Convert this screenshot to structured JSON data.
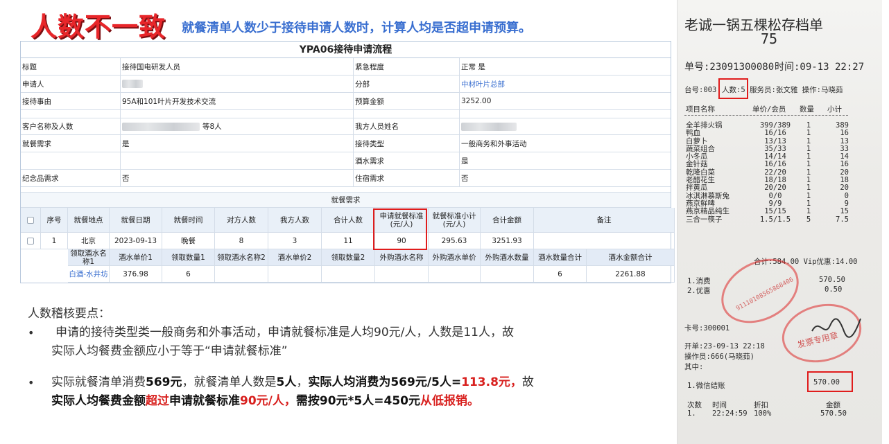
{
  "heading": {
    "big": "人数不一致",
    "sub": "就餐清单人数少于接待申请人数时，计算人均是否超申请预算。"
  },
  "form": {
    "title": "YPA06接待申请流程",
    "rows": [
      {
        "l1": "标题",
        "v1": "接待国电研发人员",
        "l2": "紧急程度",
        "v2": "正常 是"
      },
      {
        "l1": "申请人",
        "v1": "",
        "l2": "分部",
        "v2": "中材叶片总部"
      },
      {
        "l1": "接待事由",
        "v1": "95A和101叶片开发技术交流",
        "l2": "预算金额",
        "v2": "3252.00"
      },
      {
        "l1": "客户名称及人数",
        "v1": "等8人",
        "l2": "我方人员姓名",
        "v2": ""
      },
      {
        "l1": "就餐需求",
        "v1": "是",
        "l2": "接待类型",
        "v2": "一般商务和外事活动"
      },
      {
        "l1": "",
        "v1": "",
        "l2": "酒水需求",
        "v2": "是"
      },
      {
        "l1": "纪念品需求",
        "v1": "否",
        "l2": "住宿需求",
        "v2": "否"
      }
    ],
    "meal_title": "就餐需求",
    "meal_headers": [
      "序号",
      "就餐地点",
      "就餐日期",
      "就餐时间",
      "对方人数",
      "我方人数",
      "合计人数",
      "申请就餐标准(元/人)",
      "就餐标准小计(元/人)",
      "合计金额",
      "备注"
    ],
    "meal_row": {
      "seq": "1",
      "place": "北京",
      "date": "2023-09-13",
      "time": "晚餐",
      "guest": "8",
      "host": "3",
      "total": "11",
      "std": "90",
      "subtotal": "295.63",
      "amount": "3251.93",
      "remark": ""
    },
    "wine_headers": [
      "领取酒水名称1",
      "酒水单价1",
      "领取数量1",
      "领取酒水名称2",
      "酒水单价2",
      "领取数量2",
      "外购酒水名称",
      "外购酒水单价",
      "外购酒水数量",
      "酒水数量合计",
      "酒水金额合计"
    ],
    "wine_row": {
      "name1": "白酒-水井坊",
      "price1": "376.98",
      "qty1": "6",
      "name2": "",
      "price2": "",
      "qty2": "",
      "ext_name": "",
      "ext_price": "",
      "ext_qty": "",
      "qty_total": "6",
      "amount_total": "2261.88"
    }
  },
  "notes": {
    "heading": "人数稽核要点：",
    "bullet": "•",
    "p1_line1": "申请的接待类型类一般商务和外事活动，申请就餐标准是人均90元/人，人数是11人，故",
    "p1_line2": "实际人均餐费金额应小于等于“申请就餐标准”",
    "p2_a": "实际就餐清单消费",
    "p2_b": "569元",
    "p2_c": "，就餐清单人数是",
    "p2_d": "5人",
    "p2_e": "，",
    "p2_f": "实际人均消费为569元/5人=",
    "p2_g": "113.8元，",
    "p2_h": "故",
    "p3_a": "实际人均餐费金额",
    "p3_b": "超过",
    "p3_c": "申请就餐标准",
    "p3_d": "90元/人，",
    "p3_e": "需按90元*5人=450元",
    "p3_f": "从低报销。"
  },
  "receipt": {
    "title": "老诚一锅五棵松存档单",
    "num": "75",
    "order_no": "单号:23091300080",
    "time": "时间:09-13 22:27",
    "table_line_a": "台号:003",
    "persons": "人数:5",
    "table_line_b": "服务员:张文雅 操作:马晓茹",
    "col_name": "项目名称",
    "col_price": "单价/会员",
    "col_qty": "数量",
    "col_sub": "小计",
    "items": [
      [
        "全羊排火锅",
        "399/389",
        "1",
        "389"
      ],
      [
        "鸭血",
        "16/16",
        "1",
        "16"
      ],
      [
        "白萝卜",
        "13/13",
        "1",
        "13"
      ],
      [
        "蔬菜组合",
        "35/33",
        "1",
        "33"
      ],
      [
        "小冬瓜",
        "14/14",
        "1",
        "14"
      ],
      [
        "金针菇",
        "16/16",
        "1",
        "16"
      ],
      [
        "乾隆白菜",
        "22/20",
        "1",
        "20"
      ],
      [
        "老醋花生",
        "18/18",
        "1",
        "18"
      ],
      [
        "拌黄瓜",
        "20/20",
        "1",
        "20"
      ],
      [
        "冰淇淋慕斯兔",
        "0/0",
        "1",
        "0"
      ],
      [
        "燕京鲜啤",
        "9/9",
        "1",
        "9"
      ],
      [
        "燕京精品纯生",
        "15/15",
        "1",
        "15"
      ],
      [
        "三合一筷子",
        "1.5/1.5",
        "5",
        "7.5"
      ]
    ],
    "total_line": "合计:584.00 Vip优惠:14.00",
    "pay1": "1.消费",
    "pay1_val": "570.50",
    "pay2": "2.优惠",
    "pay2_val": "0.50",
    "card": "卡号:300001",
    "open": "开单:23-09-13 22:18",
    "operator": "操作员:666(马晓茹)",
    "among": "其中:",
    "wechat": "1.微信结账",
    "wechat_val": "570.00",
    "foot_h1": "次数",
    "foot_h2": "时间",
    "foot_h3": "折扣",
    "foot_h4": "金额",
    "foot_v1": "1.",
    "foot_v2": "22:24:59",
    "foot_v3": "100%",
    "foot_v4": "570.50",
    "stamp_text": "发票专用章",
    "stamp_num": "91110108565868406"
  },
  "colors": {
    "accent_red": "#e01c1c",
    "title_blue": "#3a6fd0"
  }
}
